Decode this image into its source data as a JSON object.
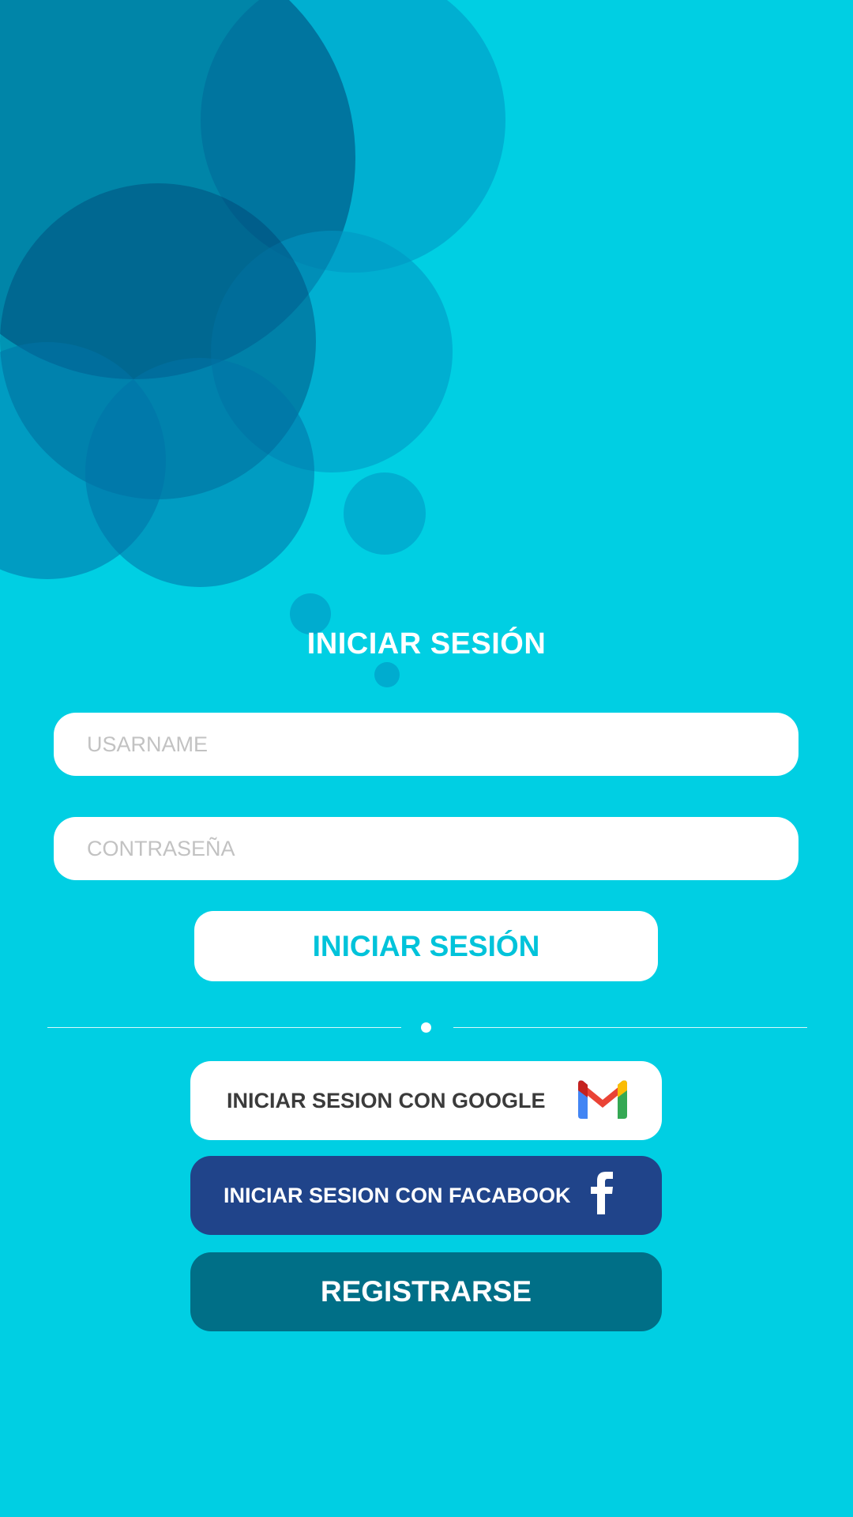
{
  "login": {
    "title": "INICIAR SESIÓN",
    "username_placeholder": "USARNAME",
    "password_placeholder": "CONTRASEÑA",
    "login_button_label": "INICIAR SESIÓN"
  },
  "social": {
    "google_label": "INICIAR SESION CON GOOGLE",
    "google_icon": "gmail-icon",
    "facebook_label": "INICIAR SESION CON FACABOOK",
    "facebook_icon": "facebook-icon",
    "register_label": "REGISTRARSE"
  },
  "colors": {
    "background": "#00CFE3",
    "accent": "#00C3DA",
    "facebook": "#20448A",
    "register": "#006F87"
  }
}
